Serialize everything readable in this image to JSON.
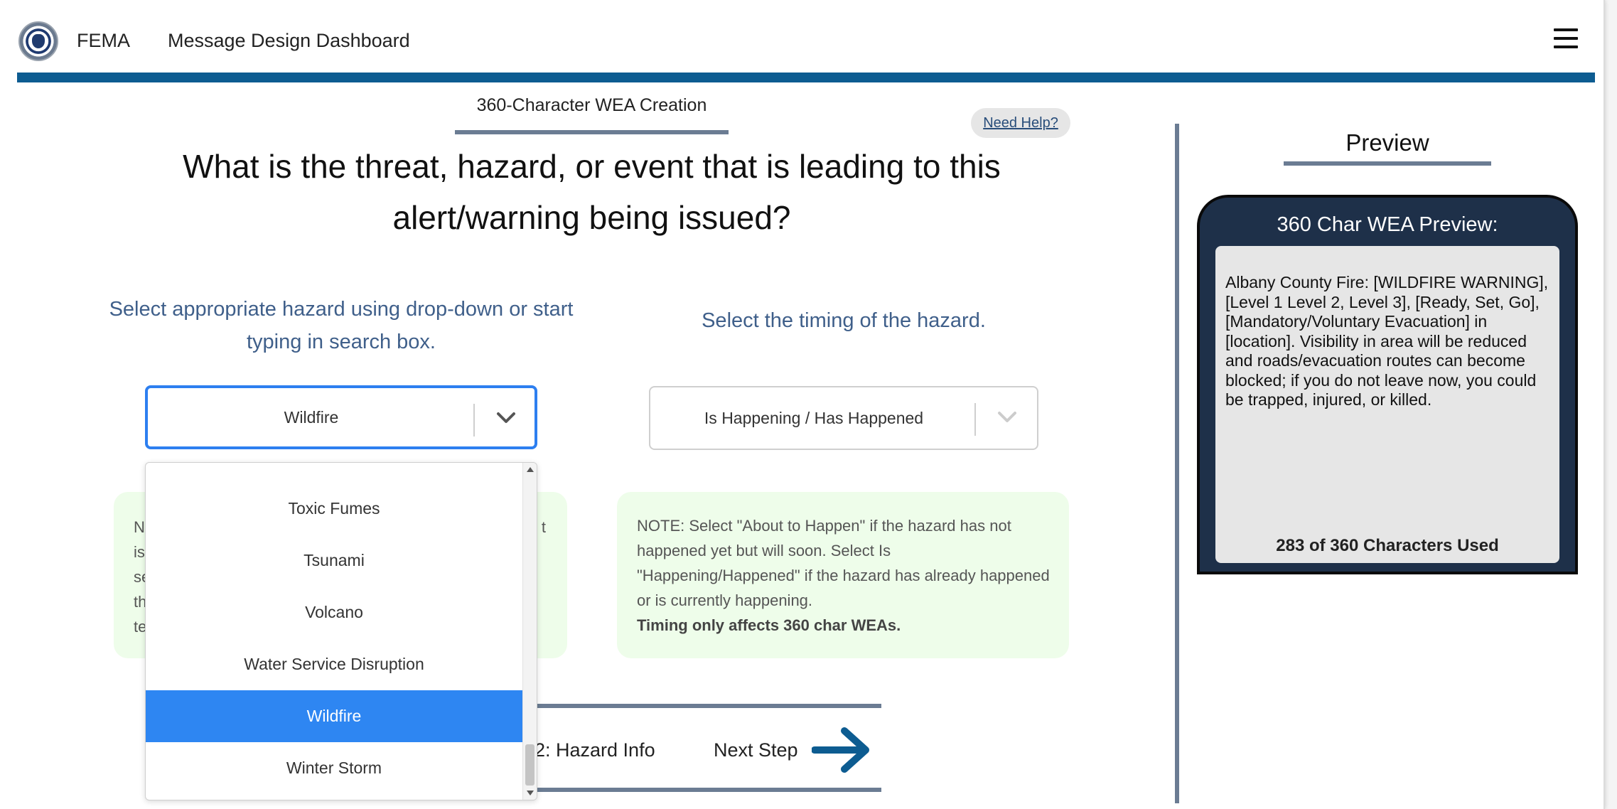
{
  "header": {
    "brand": "FEMA",
    "title": "Message Design Dashboard"
  },
  "tab": {
    "label": "360-Character WEA Creation"
  },
  "help": {
    "label": "Need Help?"
  },
  "question": "What is the threat, hazard, or event that is leading to this alert/warning being issued?",
  "hazard": {
    "prompt": "Select appropriate hazard using drop-down or start typing in search box.",
    "selected": "Wildfire",
    "options": [
      "Toxic Fumes",
      "Tsunami",
      "Volcano",
      "Water Service Disruption",
      "Wildfire",
      "Winter Storm"
    ],
    "note_fragments": [
      "N",
      "t",
      "is",
      "se",
      "th",
      "te"
    ]
  },
  "timing": {
    "prompt": "Select the timing of the hazard.",
    "selected": "Is Happening / Has Happened",
    "note": "NOTE: Select \"About to Happen\" if the hazard has not happened yet but will soon. Select Is \"Happening/Happened\" if the hazard has already happened or is currently happening.",
    "note_bold": "Timing only affects 360 char WEAs."
  },
  "step_nav": {
    "current_step": "2: Hazard Info",
    "next_label": "Next Step"
  },
  "preview": {
    "title": "Preview",
    "phone_title": "360 Char WEA Preview:",
    "message": "Albany County Fire: [WILDFIRE WARNING], [Level 1 Level 2, Level 3], [Ready, Set, Go], [Mandatory/Voluntary Evacuation] in [location]. Visibility in area will be reduced and roads/evacuation routes can become blocked; if you do not leave now, you could be trapped, injured, or killed.",
    "char_count": "283 of 360 Characters Used"
  },
  "colors": {
    "header_bar": "#0d5c91",
    "accent_blue": "#2e86f2",
    "note_green": "#eefdea",
    "prompt_blue": "#3f5f8a",
    "phone_navy": "#1e3049",
    "divider_slate": "#6b7c93"
  },
  "icons": {
    "seal": "dhs-seal-icon",
    "menu": "hamburger-menu-icon",
    "dropdown": "chevron-down-icon",
    "next": "arrow-right-icon"
  }
}
